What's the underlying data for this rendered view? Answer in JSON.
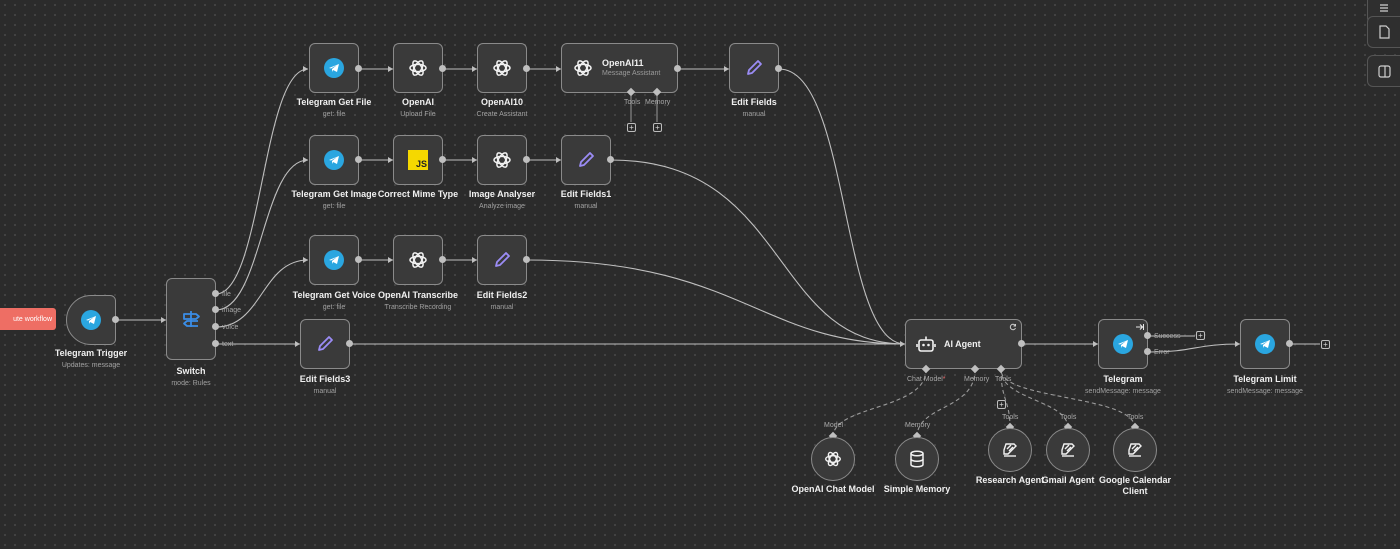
{
  "toolbar": {
    "execute_label": "ute workflow"
  },
  "colors": {
    "canvas": "#2b2b2b",
    "node": "#3a3a3a",
    "edge": "#bfbfbf",
    "execute": "#ee6e64",
    "telegram": "#2aa6e0",
    "javascript": "#f5d800",
    "edit": "#9b8cf5"
  },
  "nodes": {
    "telegram_trigger": {
      "title": "Telegram Trigger",
      "subtitle": "Updates: message",
      "icon": "telegram-icon"
    },
    "switch": {
      "title": "Switch",
      "subtitle": "mode: Rules",
      "icon": "signpost-icon",
      "outputs": [
        "file",
        "image",
        "voice",
        "text"
      ]
    },
    "telegram_get_file": {
      "title": "Telegram Get File",
      "subtitle": "get: file",
      "icon": "telegram-icon"
    },
    "openai": {
      "title": "OpenAI",
      "subtitle": "Upload File",
      "icon": "openai-icon"
    },
    "openai10": {
      "title": "OpenAI10",
      "subtitle": "Create Assistant",
      "icon": "openai-icon"
    },
    "openai11": {
      "title": "OpenAI11",
      "subtitle": "Message Assistant",
      "icon": "openai-icon",
      "ports": [
        "Tools",
        "Memory"
      ]
    },
    "edit_fields": {
      "title": "Edit Fields",
      "subtitle": "manual",
      "icon": "pencil-icon"
    },
    "telegram_get_image": {
      "title": "Telegram Get Image",
      "subtitle": "get: file",
      "icon": "telegram-icon"
    },
    "correct_mime_type": {
      "title": "Correct Mime Type",
      "subtitle": "",
      "icon": "javascript-icon",
      "icon_text": "JS"
    },
    "image_analyser": {
      "title": "Image Analyser",
      "subtitle": "Analyze image",
      "icon": "openai-icon"
    },
    "edit_fields1": {
      "title": "Edit Fields1",
      "subtitle": "manual",
      "icon": "pencil-icon"
    },
    "telegram_get_voice": {
      "title": "Telegram Get Voice",
      "subtitle": "get: file",
      "icon": "telegram-icon"
    },
    "openai_transcribe": {
      "title": "OpenAI Transcribe",
      "subtitle": "Transcribe Recording",
      "icon": "openai-icon"
    },
    "edit_fields2": {
      "title": "Edit Fields2",
      "subtitle": "manual",
      "icon": "pencil-icon"
    },
    "edit_fields3": {
      "title": "Edit Fields3",
      "subtitle": "manual",
      "icon": "pencil-icon"
    },
    "ai_agent": {
      "title": "AI Agent",
      "subtitle": "",
      "icon": "robot-icon",
      "ports": {
        "chat_model": "Chat Model",
        "required": "*",
        "memory": "Memory",
        "tools": "Tools"
      }
    },
    "telegram": {
      "title": "Telegram",
      "subtitle": "sendMessage: message",
      "icon": "telegram-icon",
      "outputs": [
        "Success",
        "Error"
      ]
    },
    "telegram_limit": {
      "title": "Telegram Limit",
      "subtitle": "sendMessage: message",
      "icon": "telegram-icon"
    },
    "openai_chat_model": {
      "title": "OpenAI Chat Model",
      "port": "Model",
      "icon": "openai-icon"
    },
    "simple_memory": {
      "title": "Simple Memory",
      "port": "Memory",
      "icon": "database-icon"
    },
    "research_agent": {
      "title": "Research Agent",
      "port": "Tools",
      "icon": "tool-agent-icon"
    },
    "gmail_agent": {
      "title": "Gmail Agent",
      "port": "Tools",
      "icon": "tool-agent-icon"
    },
    "google_calendar_client": {
      "title": "Google Calendar",
      "title2": "Client",
      "port": "Tools",
      "icon": "tool-agent-icon"
    }
  },
  "side_panel": {
    "icons": [
      "menu-icon",
      "sticky-note-icon",
      "panel-icon"
    ]
  }
}
